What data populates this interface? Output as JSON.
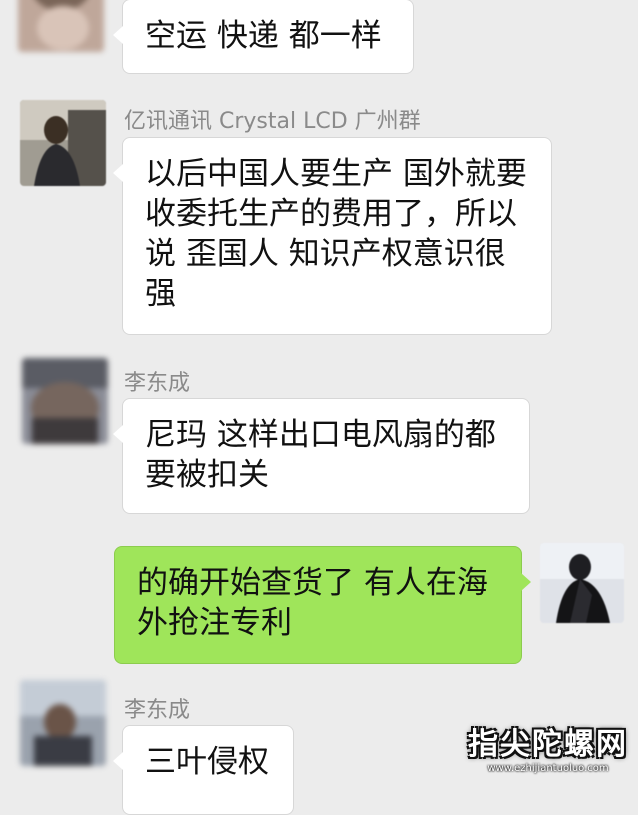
{
  "messages": [
    {
      "sender": "",
      "text": "空运 快递 都一样",
      "side": "left"
    },
    {
      "sender": "亿讯通讯 Crystal LCD 广州群",
      "text": "以后中国人要生产 国外就要收委托生产的费用了，所以说 歪国人 知识产权意识很强",
      "side": "left"
    },
    {
      "sender": "李东成",
      "text": "尼玛 这样出口电风扇的都要被扣关",
      "side": "left"
    },
    {
      "sender": "",
      "text": "的确开始查货了 有人在海外抢注专利",
      "side": "right"
    },
    {
      "sender": "李东成",
      "text": "三叶侵权",
      "side": "left"
    }
  ],
  "watermark": {
    "title": "指尖陀螺网",
    "url": "www.ezhijiantuoluo.com"
  },
  "colors": {
    "background": "#ececec",
    "incoming_bubble": "#ffffff",
    "outgoing_bubble": "#9fe55a",
    "sender_name": "#8a8a8a"
  }
}
